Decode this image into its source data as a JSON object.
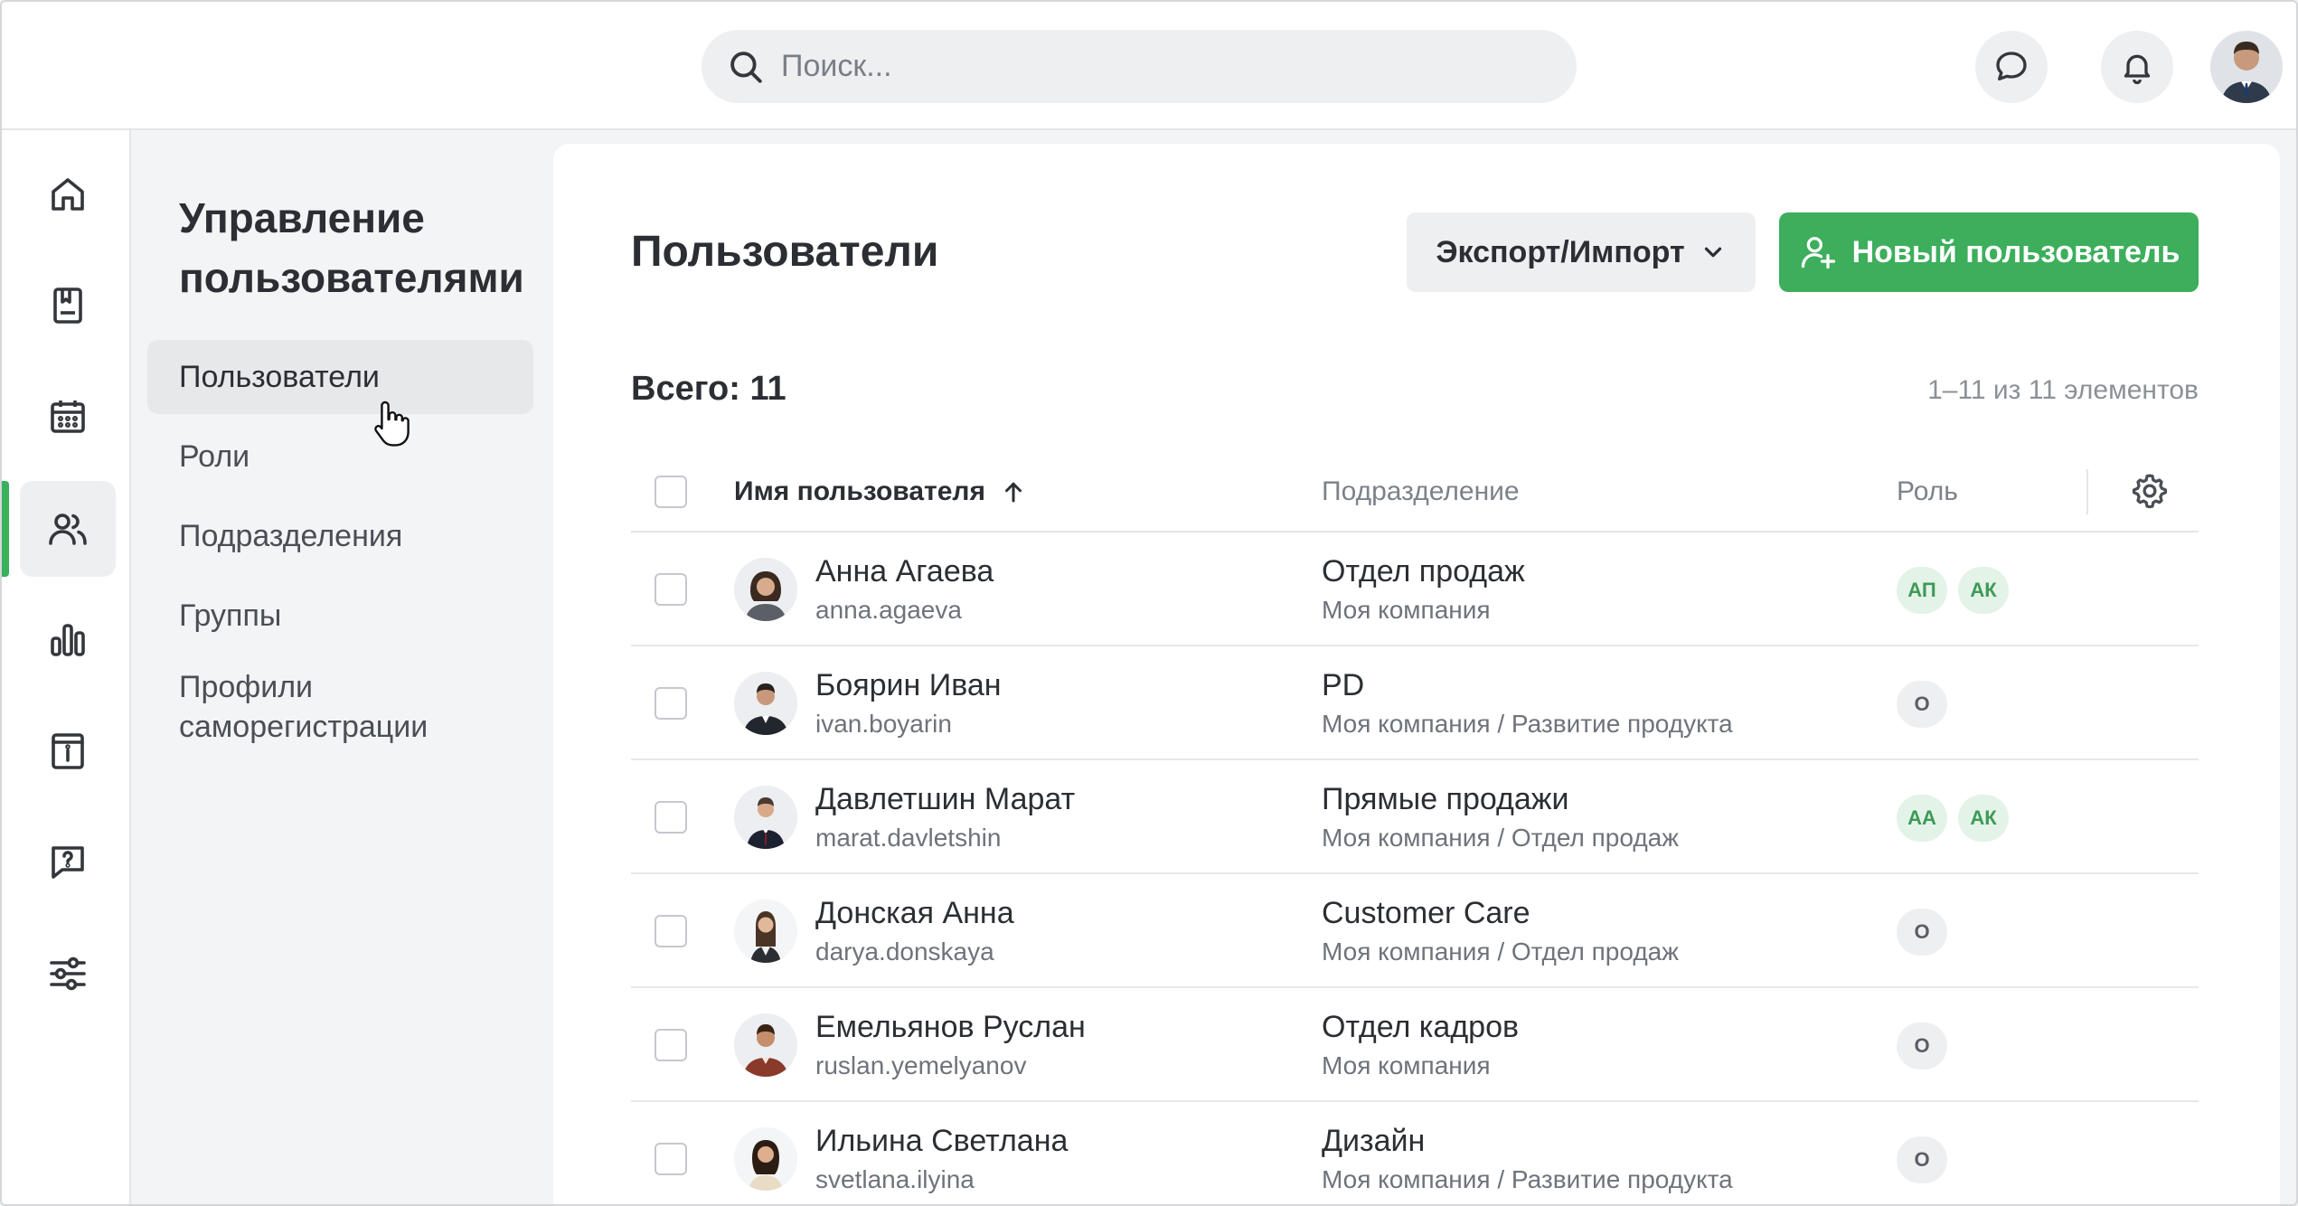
{
  "search": {
    "placeholder": "Поиск..."
  },
  "subnav": {
    "title": "Управление пользователями",
    "items": [
      "Пользователи",
      "Роли",
      "Подразделения",
      "Группы",
      "Профили саморегистрации"
    ]
  },
  "page": {
    "title": "Пользователи",
    "export_label": "Экспорт/Импорт",
    "new_user_label": "Новый пользователь",
    "total": "Всего: 11",
    "range": "1–11 из 11 элементов"
  },
  "table": {
    "columns": [
      "Имя пользователя",
      "Подразделение",
      "Роль"
    ],
    "rows": [
      {
        "name": "Анна Агаева",
        "login": "anna.agaeva",
        "dept": "Отдел продаж",
        "path": "Моя компания",
        "roles": [
          "АП",
          "АК"
        ],
        "role_style": "green"
      },
      {
        "name": "Боярин Иван",
        "login": "ivan.boyarin",
        "dept": "PD",
        "path": "Моя компания / Развитие продукта",
        "roles": [
          "О"
        ],
        "role_style": "gray"
      },
      {
        "name": "Давлетшин Марат",
        "login": "marat.davletshin",
        "dept": "Прямые продажи",
        "path": "Моя компания / Отдел продаж",
        "roles": [
          "АА",
          "АК"
        ],
        "role_style": "green"
      },
      {
        "name": "Донская Анна",
        "login": "darya.donskaya",
        "dept": "Customer Care",
        "path": "Моя компания / Отдел продаж",
        "roles": [
          "О"
        ],
        "role_style": "gray"
      },
      {
        "name": "Емельянов Руслан",
        "login": "ruslan.yemelyanov",
        "dept": "Отдел кадров",
        "path": "Моя компания",
        "roles": [
          "О"
        ],
        "role_style": "gray"
      },
      {
        "name": "Ильина Светлана",
        "login": "svetlana.ilyina",
        "dept": "Дизайн",
        "path": "Моя компания / Развитие продукта",
        "roles": [
          "О"
        ],
        "role_style": "gray"
      }
    ]
  },
  "colors": {
    "accent": "#3dae5c",
    "active_bar": "#39b05a",
    "role_green_bg": "#e3f3e7",
    "role_green_fg": "#3d9a57"
  }
}
